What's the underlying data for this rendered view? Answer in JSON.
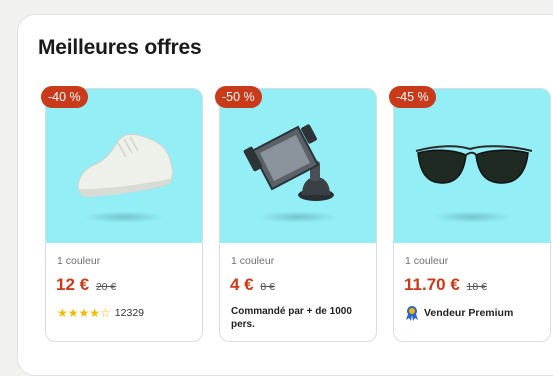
{
  "section": {
    "title": "Meilleures offres"
  },
  "products": [
    {
      "discount": "-40 %",
      "colors": "1 couleur",
      "price": "12 €",
      "old_price": "20 €",
      "stars": "★★★★☆",
      "reviews": "12329",
      "icon": "sneaker-image"
    },
    {
      "discount": "-50 %",
      "colors": "1 couleur",
      "price": "4 €",
      "old_price": "8 €",
      "note": "Commandé par + de 1000 pers.",
      "icon": "phone-holder-image"
    },
    {
      "discount": "-45 %",
      "colors": "1 couleur",
      "price": "11.70 €",
      "old_price": "18 €",
      "seller_label": "Vendeur Premium",
      "icon": "sunglasses-image"
    }
  ],
  "colors": {
    "accent": "#c93a1a",
    "image_bg": "#93eef6",
    "star": "#f5b800"
  }
}
